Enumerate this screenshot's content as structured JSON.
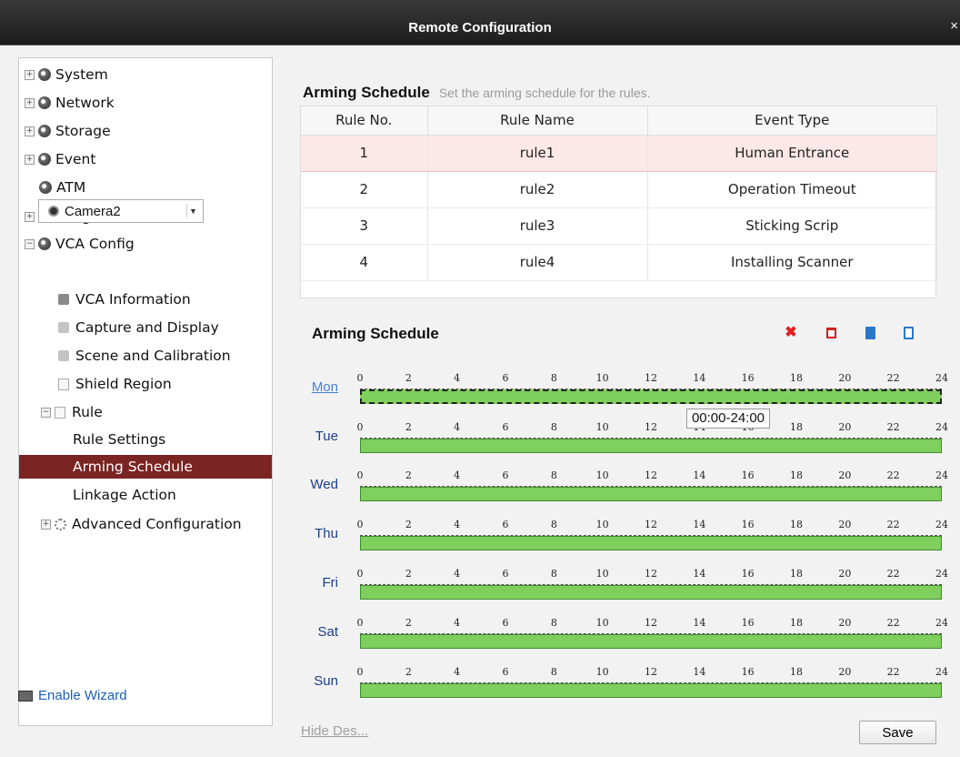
{
  "window": {
    "title": "Remote Configuration",
    "close_glyph": "×"
  },
  "sidebar": {
    "items": [
      {
        "label": "System",
        "expander": "+",
        "icon": "gear-globe-icon"
      },
      {
        "label": "Network",
        "expander": "+",
        "icon": "gear-globe-icon"
      },
      {
        "label": "Storage",
        "expander": "+",
        "icon": "gear-globe-icon"
      },
      {
        "label": "Event",
        "expander": "+",
        "icon": "gear-globe-icon"
      },
      {
        "label": "ATM",
        "expander": "",
        "icon": "gear-globe-icon"
      },
      {
        "label": "Image",
        "expander": "+",
        "icon": "gear-globe-icon"
      },
      {
        "label": "VCA Config",
        "expander": "−",
        "icon": "gear-globe-icon"
      }
    ],
    "camera_select": {
      "value": "Camera2"
    },
    "vca_items": [
      {
        "label": "VCA Information",
        "icon": "info-icon"
      },
      {
        "label": "Capture and Display",
        "icon": "camera-icon"
      },
      {
        "label": "Scene and Calibration",
        "icon": "scene-icon"
      },
      {
        "label": "Shield Region",
        "icon": "shield-region-icon"
      }
    ],
    "rule": {
      "label": "Rule",
      "expander": "−"
    },
    "rule_children": [
      {
        "label": "Rule Settings"
      },
      {
        "label": "Arming Schedule",
        "selected": true
      },
      {
        "label": "Linkage Action"
      }
    ],
    "advanced": {
      "label": "Advanced Configuration",
      "expander": "+"
    },
    "enable_wizard": "Enable Wizard"
  },
  "header": {
    "title": "Arming Schedule",
    "subtitle": "Set the arming schedule for the rules."
  },
  "rules_table": {
    "columns": [
      "Rule No.",
      "Rule Name",
      "Event Type"
    ],
    "rows": [
      [
        "1",
        "rule1",
        "Human Entrance"
      ],
      [
        "2",
        "rule2",
        "Operation Timeout"
      ],
      [
        "3",
        "rule3",
        "Sticking Scrip"
      ],
      [
        "4",
        "rule4",
        "Installing Scanner"
      ]
    ],
    "selected_row": 0
  },
  "schedule": {
    "title": "Arming Schedule",
    "tick_labels": [
      "0",
      "2",
      "4",
      "6",
      "8",
      "10",
      "12",
      "14",
      "16",
      "18",
      "20",
      "22",
      "24"
    ],
    "days": [
      {
        "label": "Mon",
        "start": 0,
        "end": 24,
        "selected": true
      },
      {
        "label": "Tue",
        "start": 0,
        "end": 24
      },
      {
        "label": "Wed",
        "start": 0,
        "end": 24
      },
      {
        "label": "Thu",
        "start": 0,
        "end": 24
      },
      {
        "label": "Fri",
        "start": 0,
        "end": 24
      },
      {
        "label": "Sat",
        "start": 0,
        "end": 24
      },
      {
        "label": "Sun",
        "start": 0,
        "end": 24
      }
    ],
    "tooltip": "00:00-24:00",
    "bar_color": "#7fcf5c"
  },
  "footer": {
    "hide_des": "Hide Des...",
    "save": "Save"
  }
}
